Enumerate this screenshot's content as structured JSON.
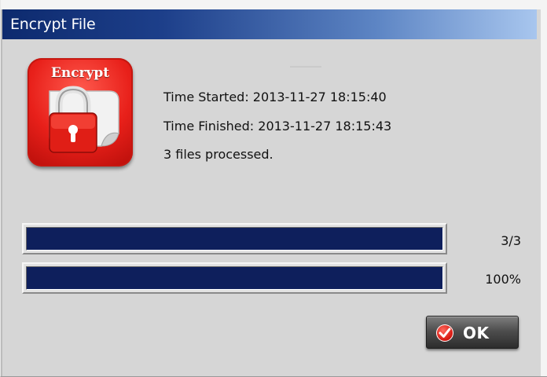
{
  "window": {
    "title": "Encrypt File"
  },
  "app_icon": {
    "label": "Encrypt",
    "icon": "padlock-document-icon"
  },
  "info": {
    "time_started": "Time Started: 2013-11-27 18:15:40",
    "time_finished": "Time Finished: 2013-11-27 18:15:43",
    "files_processed": "3 files processed."
  },
  "progress": [
    {
      "label": "3/3",
      "fraction": 1.0
    },
    {
      "label": "100%",
      "fraction": 1.0
    }
  ],
  "ok_button": {
    "label": "OK",
    "icon": "checkmark-icon"
  },
  "colors": {
    "progress_fill": "#0e1f5c",
    "title_bar_start": "#0d2a6e",
    "title_bar_end": "#a8c6ee",
    "icon_red": "#e8201a"
  }
}
